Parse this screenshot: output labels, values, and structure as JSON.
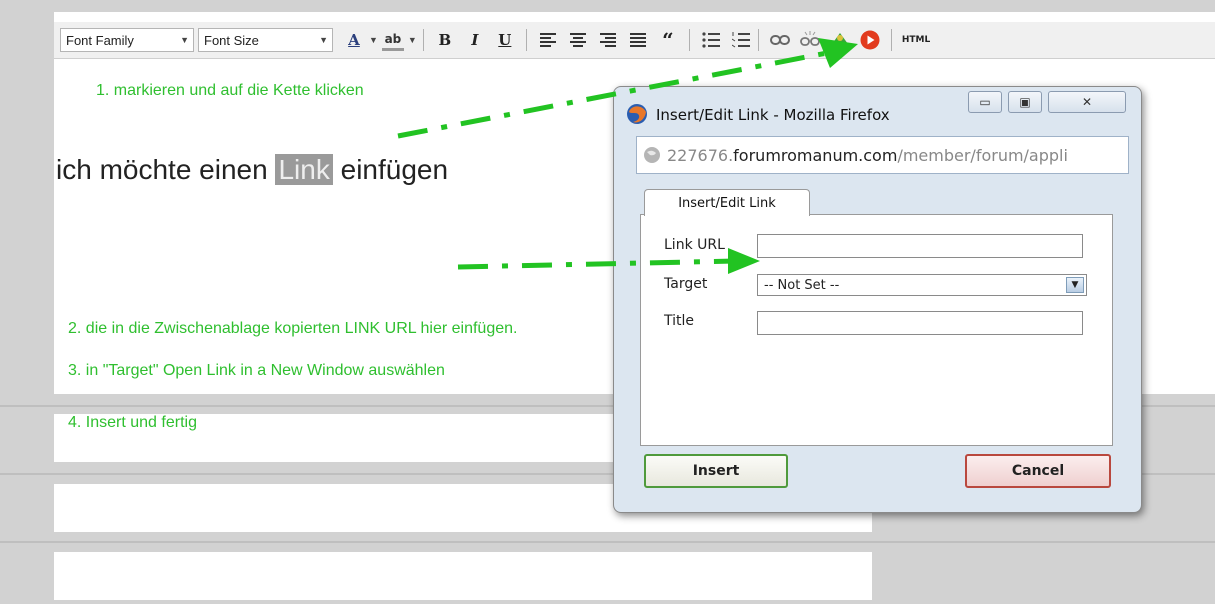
{
  "toolbar": {
    "font_family": "Font Family",
    "font_size": "Font Size",
    "font_color_glyph": "A",
    "highlight_glyph": "ab",
    "bold": "B",
    "italic": "I",
    "underline": "U",
    "blockquote": "“",
    "html_label": "HTML"
  },
  "editor": {
    "step1": "1. markieren und auf die Kette klicken",
    "text_before": "ich möchte einen",
    "text_selected": "Link",
    "text_after": "einfügen",
    "step2": "2. die in die Zwischenablage kopierten LINK URL hier einfügen.",
    "step3": "3. in \"Target\" Open Link in a New Window auswählen",
    "step4": "4. Insert und fertig"
  },
  "dialog": {
    "title": "Insert/Edit Link - Mozilla Firefox",
    "url_prefix": "227676.",
    "url_domain": "forumromanum.com",
    "url_path": "/member/forum/appli",
    "tab": "Insert/Edit Link",
    "link_url_label": "Link URL",
    "link_url_value": "",
    "target_label": "Target",
    "target_value": "-- Not Set --",
    "title_label": "Title",
    "title_value": "",
    "insert_label": "Insert",
    "cancel_label": "Cancel"
  },
  "colors": {
    "annotation_green": "#2fbf2f",
    "arrow_green": "#22c322",
    "insert_border": "#4f9a3c",
    "cancel_border": "#b9483e"
  }
}
